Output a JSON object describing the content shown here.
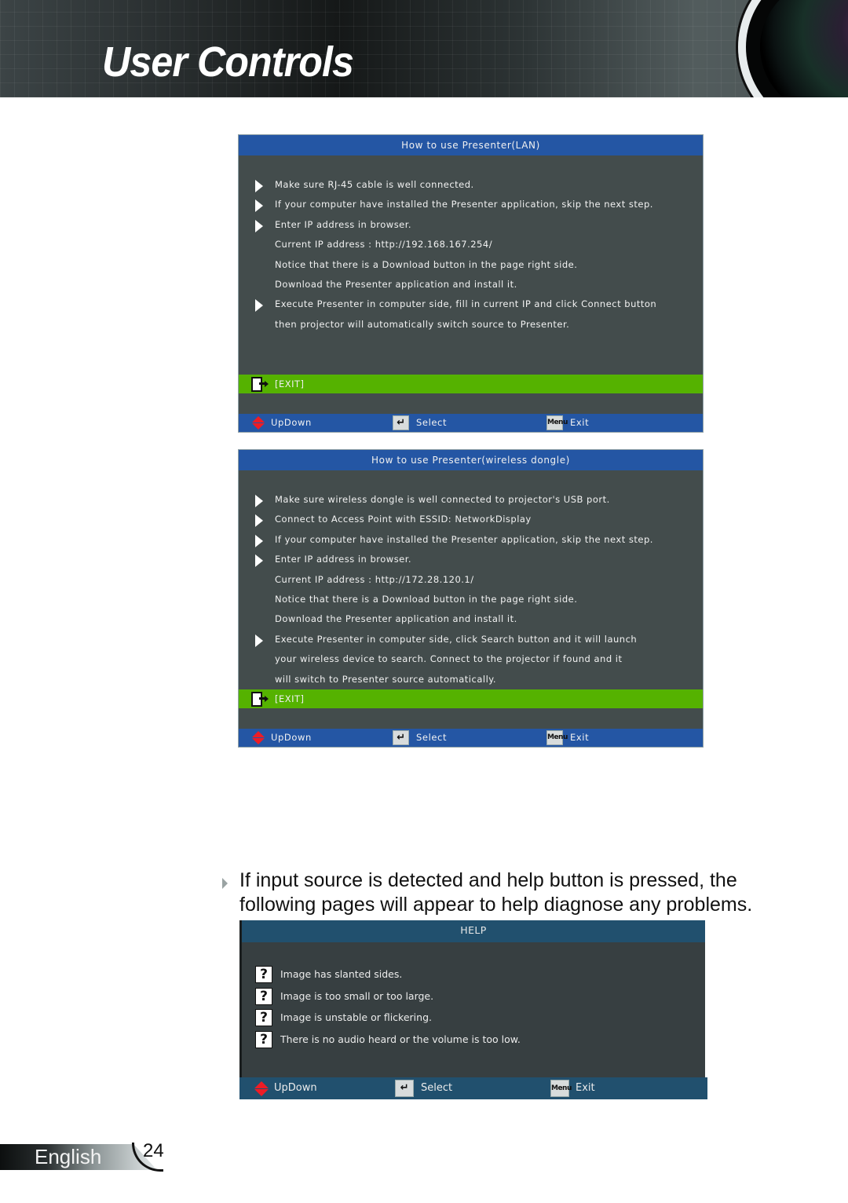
{
  "header": {
    "title": "User Controls"
  },
  "lan_window": {
    "title": "How to use Presenter(LAN)",
    "rows": [
      {
        "bullet": true,
        "text": "Make sure RJ-45 cable is well connected."
      },
      {
        "bullet": true,
        "text": "If your computer have installed the Presenter application, skip the next step."
      },
      {
        "bullet": true,
        "text": "Enter IP address in browser."
      },
      {
        "bullet": false,
        "text": "Current IP address :    http://192.168.167.254/"
      },
      {
        "bullet": false,
        "text": "Notice that there is a Download button in the page right side."
      },
      {
        "bullet": false,
        "text": "Download the Presenter application and install it."
      },
      {
        "bullet": true,
        "text": "Execute Presenter in computer side, fill in current IP and click Connect button"
      },
      {
        "bullet": false,
        "text": "then projector will automatically switch source to Presenter."
      }
    ],
    "exit_label": "[EXIT]",
    "footer": {
      "updown": "UpDown",
      "select": "Select",
      "menu_key": "Menu",
      "exit": "Exit"
    }
  },
  "wireless_window": {
    "title": "How to use Presenter(wireless dongle)",
    "rows": [
      {
        "bullet": true,
        "text": "Make sure wireless dongle is well connected to projector's USB port."
      },
      {
        "bullet": true,
        "text": "Connect to Access Point with ESSID:     NetworkDisplay"
      },
      {
        "bullet": true,
        "text": "If your computer have installed the Presenter application, skip the next step."
      },
      {
        "bullet": true,
        "text": "Enter IP address in browser."
      },
      {
        "bullet": false,
        "text": "Current IP address :    http://172.28.120.1/"
      },
      {
        "bullet": false,
        "text": "Notice that there is a Download button in the page right side."
      },
      {
        "bullet": false,
        "text": "Download the Presenter application and install it."
      },
      {
        "bullet": true,
        "text": "Execute Presenter in computer side,  click Search button and it will launch"
      },
      {
        "bullet": false,
        "text": "your wireless device to search. Connect to  the projector if found and it"
      },
      {
        "bullet": false,
        "text": "will switch to Presenter source automatically."
      }
    ],
    "exit_label": "[EXIT]",
    "footer": {
      "updown": "UpDown",
      "select": "Select",
      "menu_key": "Menu",
      "exit": "Exit"
    }
  },
  "help_intro": "If input source is detected and help button is pressed, the following pages will appear to help diagnose any problems.",
  "help_window": {
    "title": "HELP",
    "items": [
      "Image has slanted sides.",
      "Image is too small or too large.",
      "Image is unstable or flickering.",
      "There is no audio heard or the volume is too low."
    ],
    "icon_glyph": "?",
    "footer": {
      "updown": "UpDown",
      "select": "Select",
      "menu_key": "Menu",
      "exit": "Exit"
    }
  },
  "page_footer": {
    "language": "English",
    "page_number": "24"
  },
  "colors": {
    "osd_title_blue": "#2456a4",
    "osd_body": "#434c4c",
    "exit_green": "#55b200",
    "help_title": "#21506e",
    "updown_red": "#ee1c25"
  }
}
